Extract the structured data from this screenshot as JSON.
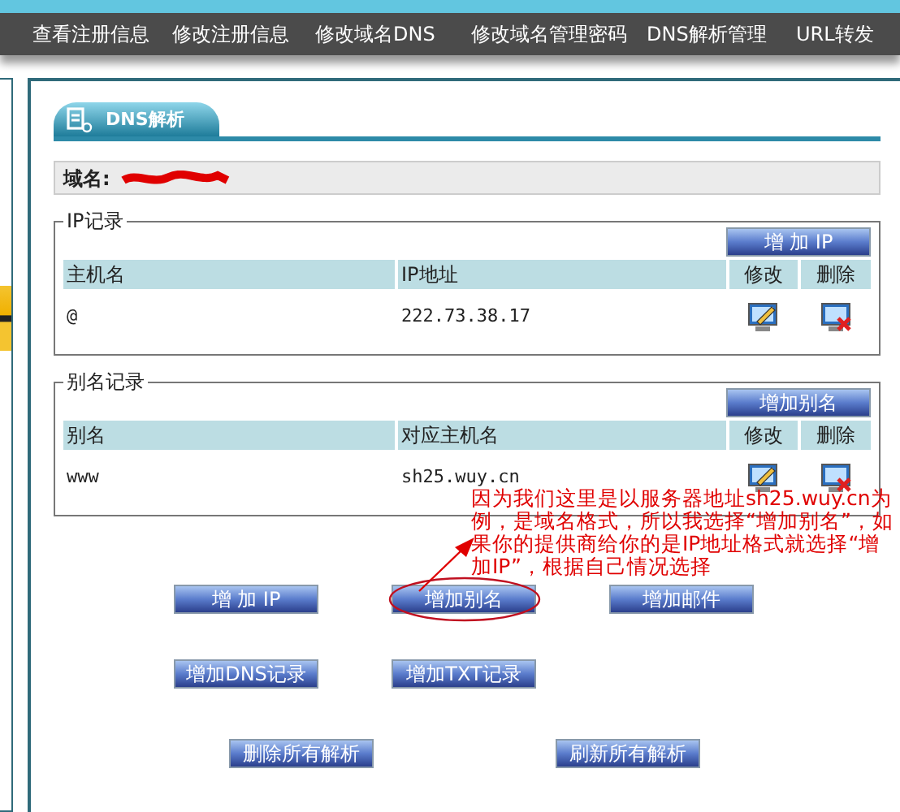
{
  "nav": [
    "查看注册信息",
    "修改注册信息",
    "修改域名DNS",
    "修改域名管理密码",
    "DNS解析管理",
    "URL转发"
  ],
  "panel": {
    "tab": "DNS解析",
    "domain_label": "域名:"
  },
  "ip_records": {
    "legend": "IP记录",
    "add_button": "增 加 IP",
    "columns": [
      "主机名",
      "IP地址",
      "修改",
      "删除"
    ],
    "rows": [
      {
        "host": "@",
        "value": "222.73.38.17"
      }
    ]
  },
  "alias_records": {
    "legend": "别名记录",
    "add_button": "增加别名",
    "columns": [
      "别名",
      "对应主机名",
      "修改",
      "删除"
    ],
    "rows": [
      {
        "host": "www",
        "value": "sh25.wuy.cn"
      }
    ]
  },
  "actions": [
    [
      {
        "label": "增 加 IP",
        "highlighted": false
      },
      {
        "label": "增加别名",
        "highlighted": true
      },
      {
        "label": "增加邮件",
        "highlighted": false
      }
    ],
    [
      {
        "label": "增加DNS记录",
        "highlighted": false
      },
      {
        "label": "增加TXT记录",
        "highlighted": false
      }
    ],
    [
      {
        "label": "删除所有解析",
        "highlighted": false
      },
      {
        "label": "刷新所有解析",
        "highlighted": false
      }
    ]
  ],
  "annotation": {
    "text": "因为我们这里是以服务器地址sh25.wuy.cn为例，是域名格式，所以我选择“增加别名”，如果你的提供商给你的是IP地址格式就选择“增加IP”，根据自己情况选择"
  }
}
